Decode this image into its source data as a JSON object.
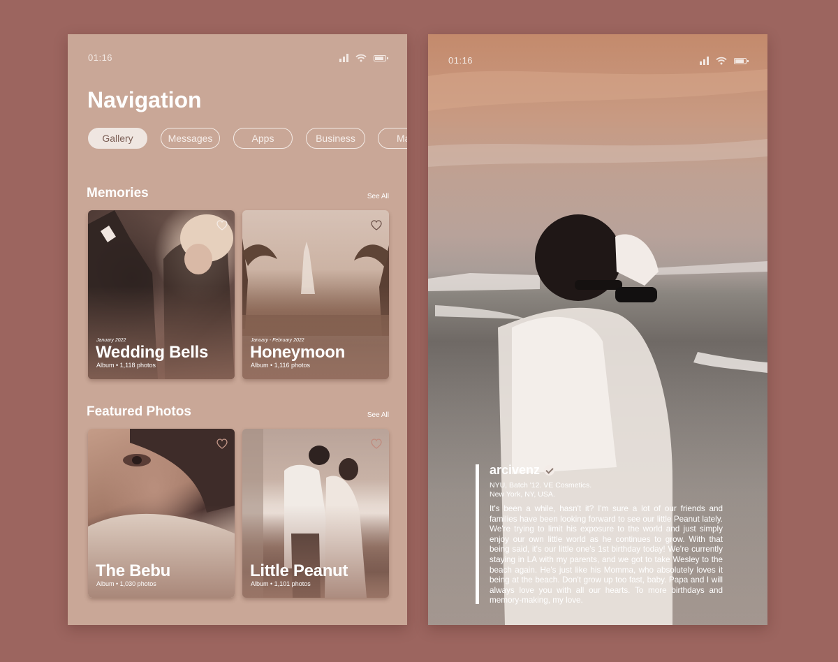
{
  "left_screen": {
    "status": {
      "time": "01:16"
    },
    "title": "Navigation",
    "tabs": [
      "Gallery",
      "Messages",
      "Apps",
      "Business",
      "Ma"
    ],
    "active_tab": "Gallery",
    "memories": {
      "heading": "Memories",
      "see_all": "See All",
      "cards": [
        {
          "date": "January 2022",
          "title": "Wedding Bells",
          "meta": "Album • 1,118 photos"
        },
        {
          "date": "January - February 2022",
          "title": "Honeymoon",
          "meta": "Album • 1,116 photos"
        }
      ]
    },
    "featured": {
      "heading": "Featured Photos",
      "see_all": "See All",
      "cards": [
        {
          "title": "The Bebu",
          "meta": "Album • 1,030 photos"
        },
        {
          "title": "Little Peanut",
          "meta": "Album • 1,101 photos"
        }
      ]
    }
  },
  "right_screen": {
    "status": {
      "time": "01:16"
    },
    "post": {
      "username": "arcivenz",
      "bio_line1": "NYU, Batch '12. VE Cosmetics.",
      "bio_line2": "New York, NY, USA.",
      "caption": "It's been a while, hasn't it? I'm sure a lot of our friends and families have been looking forward to see our little Peanut lately. We're trying to limit his exposure to the world and just simply enjoy our own little world as he continues to grow. With that being said, it's our little one's 1st birthday today! We're currently staying in LA with my parents, and we got to take Wesley to the beach again. He's just like his Momma, who absolutely loves it being at the beach. Don't grow up too fast, baby. Papa and I will always love you with all our hearts. To more birthdays and memory-making, my love."
    }
  },
  "icons": {
    "signal": "signal-icon",
    "wifi": "wifi-icon",
    "battery": "battery-icon",
    "heart": "heart-icon",
    "verified": "verified-badge-icon"
  },
  "colors": {
    "background": "#9c655f",
    "left_screen_bg": "#c9a797",
    "text": "#ffffff",
    "active_tab_bg": "#efe6e1",
    "active_tab_text": "#7b5e55"
  }
}
